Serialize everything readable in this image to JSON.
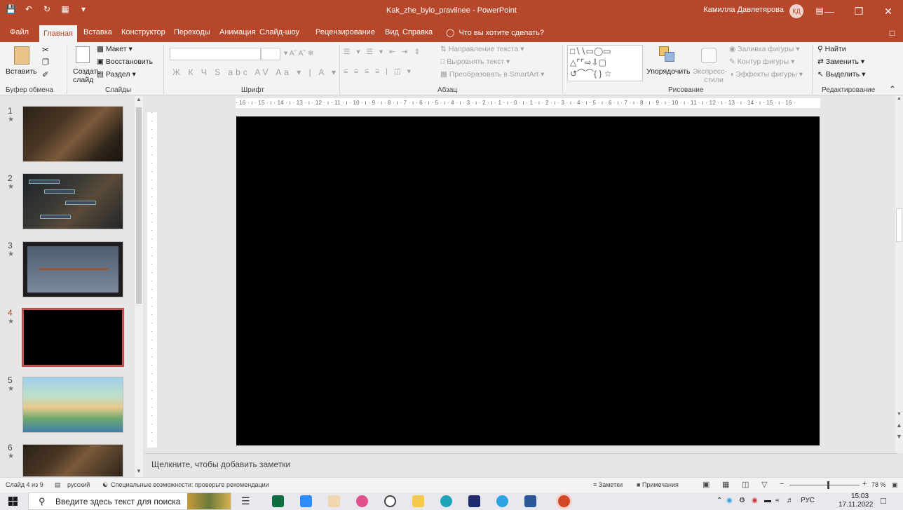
{
  "titlebar": {
    "doc_title": "Kak_zhe_bylo_pravilnee - PowerPoint",
    "user_name": "Камилла Давлетярова",
    "avatar_initials": "КД"
  },
  "tabs": [
    "Файл",
    "Главная",
    "Вставка",
    "Конструктор",
    "Переходы",
    "Анимация",
    "Слайд-шоу",
    "Рецензирование",
    "Вид",
    "Справка"
  ],
  "tell_me": "Что вы хотите сделать?",
  "ribbon": {
    "paste": "Вставить",
    "create_slide": "Создать",
    "create_slide_2": "слайд",
    "layout": "Макет",
    "reset": "Восстановить",
    "section": "Раздел",
    "text_direction": "Направление текста",
    "align_text": "Выровнять текст",
    "smartart": "Преобразовать в SmartArt",
    "arrange": "Упорядочить",
    "quick_styles": "Экспресс-",
    "quick_styles_2": "стили",
    "shape_fill": "Заливка фигуры",
    "shape_outline": "Контур фигуры",
    "shape_effects": "Эффекты фигуры",
    "find": "Найти",
    "replace": "Заменить",
    "select": "Выделить",
    "groups": {
      "clipboard": "Буфер обмена",
      "slides": "Слайды",
      "font": "Шрифт",
      "paragraph": "Абзац",
      "drawing": "Рисование",
      "editing": "Редактирование"
    }
  },
  "ruler_text": "· 16 · ı · 15 · ı · 14 · ı · 13 · ı · 12 · ı · 11 · ı · 10 · ı · 9 · ı · 8 · ı · 7 · ı · 6 · ı · 5 · ı · 4 · ı · 3 · ı · 2 · ı · 1 · ı · 0 · ı · 1 · ı · 2 · ı · 3 · ı · 4 · ı · 5 · ı · 6 · ı · 7 · ı · 8 · ı · 9 · ı · 10 · ı · 11 · ı · 12 · ı · 13 · ı · 14 · ı · 15 · ı · 16 ·",
  "thumbnails": [
    {
      "num": "1",
      "kind": "library"
    },
    {
      "num": "2",
      "kind": "library-buttons"
    },
    {
      "num": "3",
      "kind": "gray"
    },
    {
      "num": "4",
      "kind": "black",
      "selected": true
    },
    {
      "num": "5",
      "kind": "landscape"
    },
    {
      "num": "6",
      "kind": "library"
    }
  ],
  "notes_placeholder": "Щелкните, чтобы добавить заметки",
  "status": {
    "slide_counter": "Слайд 4 из 9",
    "language": "русский",
    "accessibility": "Специальные возможности: проверьте рекомендации",
    "notes_btn": "Заметки",
    "comments_btn": "Примечания",
    "zoom": "78 %"
  },
  "taskbar": {
    "search_placeholder": "Введите здесь текст для поиска",
    "keyboard_lang": "РУС",
    "time": "15:03",
    "date": "17.11.2022"
  },
  "colors": {
    "accent": "#b7472a",
    "slide_bg": "#000000"
  }
}
